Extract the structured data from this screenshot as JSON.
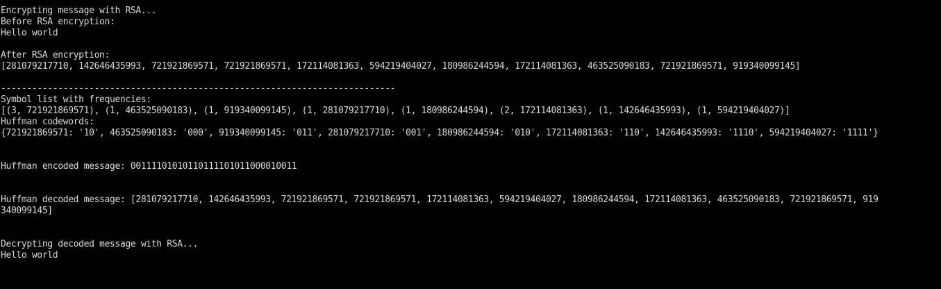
{
  "terminal": {
    "lines": [
      "---------------------------------------------------------------------------",
      "Encrypting message with RSA...",
      "Before RSA encryption:",
      "Hello world",
      "",
      "After RSA encryption:",
      "[281079217710, 142646435993, 721921869571, 721921869571, 172114081363, 594219404027, 180986244594, 172114081363, 463525090183, 721921869571, 919340099145]",
      "",
      "----------------------------------------------------------------------------",
      "Symbol list with frequencies:",
      "[(3, 721921869571), (1, 463525090183), (1, 919340099145), (1, 281079217710), (1, 180986244594), (2, 172114081363), (1, 142646435993), (1, 594219404027)]",
      "Huffman codewords:",
      "{721921869571: '10', 463525090183: '000', 919340099145: '011', 281079217710: '001', 180986244594: '010', 172114081363: '110', 142646435993: '1110', 594219404027: '1111'}",
      "",
      "",
      "Huffman encoded message: 0011110101011011110101100001001​1",
      "",
      "",
      "Huffman decoded message: [281079217710, 142646435993, 721921869571, 721921869571, 172114081363, 594219404027, 180986244594, 172114081363, 463525090183, 721921869571, 919",
      "340099145]",
      "",
      "",
      "Decrypting decoded message with RSA...",
      "Hello world",
      "",
      ""
    ]
  },
  "colors": {
    "background": "#000000",
    "foreground": "#d9d9d9"
  }
}
